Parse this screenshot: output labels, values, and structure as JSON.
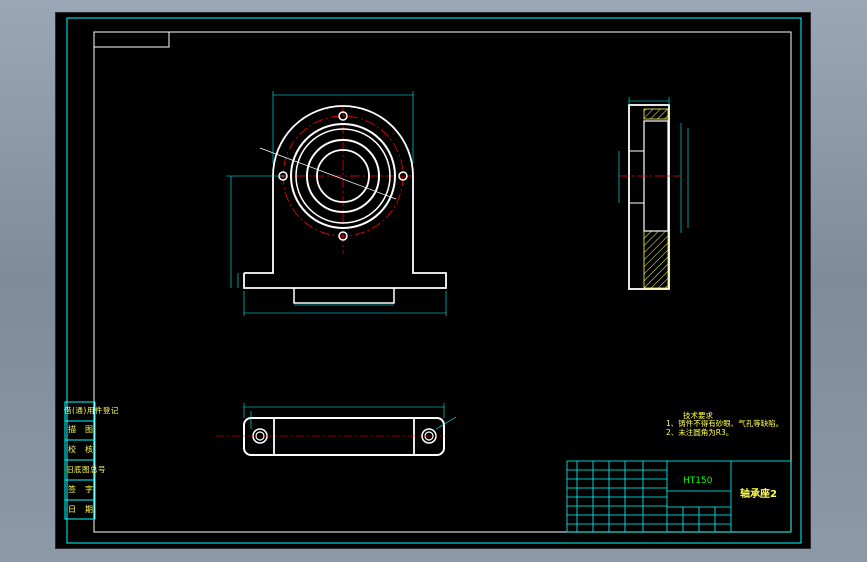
{
  "side_labels": [
    "借(通)用件登记",
    "描　图",
    "校　核",
    "旧底图总号",
    "签　字",
    "日　期"
  ],
  "tech_notes": {
    "heading": "技术要求",
    "line1": "1、铸件不得有砂眼、气孔等缺陷。",
    "line2": "2、未注圆角为R3。"
  },
  "title_block": {
    "material": "HT150",
    "part_name": "轴承座2"
  },
  "colors": {
    "frame": "#00ffff",
    "part": "#ffffff",
    "center": "#ff0000",
    "dim": "#00ffff",
    "hatch": "#ffff55",
    "text_yellow": "#ffff55",
    "text_green": "#00ff00"
  }
}
